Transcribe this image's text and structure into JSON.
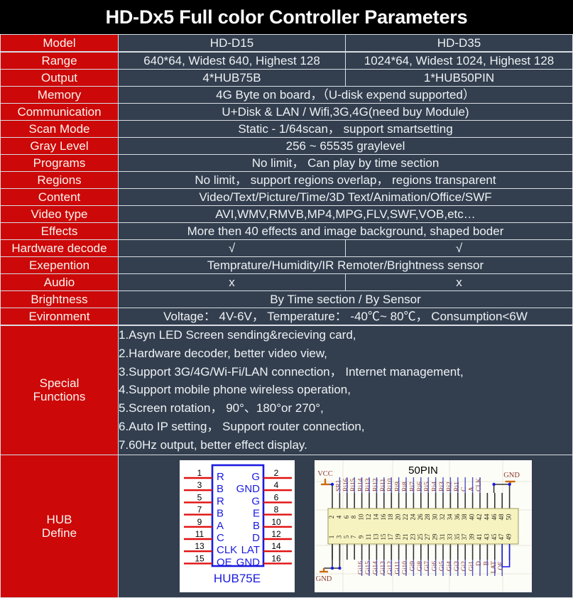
{
  "title": "HD-Dx5 Full color Controller Parameters",
  "columns": {
    "label": "Model",
    "col1": "HD-D15",
    "col2": "HD-D35"
  },
  "rows": [
    {
      "label": "Range",
      "split": true,
      "v1": "640*64, Widest 640, Highest 128",
      "v2": "1024*64, Widest 1024, Highest 128"
    },
    {
      "label": "Output",
      "split": true,
      "v1": "4*HUB75B",
      "v2": "1*HUB50PIN"
    },
    {
      "label": "Memory",
      "split": false,
      "v1": "4G Byte on board，（U-disk expend supported）"
    },
    {
      "label": "Communication",
      "split": false,
      "v1": "U+Disk & LAN / Wifi,3G,4G(need buy Module)"
    },
    {
      "label": "Scan Mode",
      "split": false,
      "v1": "Static - 1/64scan， support smartsetting"
    },
    {
      "label": "Gray Level",
      "split": false,
      "v1": "256 ~ 65535 graylevel"
    },
    {
      "label": "Programs",
      "split": false,
      "v1": "No limit， Can play by time section"
    },
    {
      "label": "Regions",
      "split": false,
      "v1": "No limit， support regions overlap， regions transparent"
    },
    {
      "label": "Content",
      "split": false,
      "v1": "Video/Text/Picture/Time/3D Text/Animation/Office/SWF"
    },
    {
      "label": "Video type",
      "split": false,
      "v1": "AVI,WMV,RMVB,MP4,MPG,FLV,SWF,VOB,etc…"
    },
    {
      "label": "Effects",
      "split": false,
      "v1": "More then 40 effects and image background, shaped boder"
    },
    {
      "label": "Hardware decode",
      "split": true,
      "v1": "√",
      "v2": "√"
    },
    {
      "label": "Exepention",
      "split": false,
      "v1": "Temprature/Humidity/IR Remoter/Brightness sensor"
    },
    {
      "label": "Audio",
      "split": true,
      "v1": "x",
      "v2": "x"
    },
    {
      "label": "Brightness",
      "split": false,
      "v1": "By Time section / By Sensor"
    },
    {
      "label": "Evironment",
      "split": false,
      "v1": "Voltage： 4V-6V， Temperature： -40℃~ 80℃， Consumption<6W"
    }
  ],
  "special": {
    "label_line1": "Special",
    "label_line2": "Functions",
    "items": [
      "1.Asyn LED Screen sending&recieving card,",
      "2.Hardware decoder, better video view,",
      "3.Support 3G/4G/Wi-Fi/LAN connection， Internet management,",
      "4.Support mobile phone wireless operation,",
      "5.Screen rotation， 90°、180°or 270°,",
      "6.Auto IP setting， Support router connection,",
      "7.60Hz output, better effect display."
    ]
  },
  "hub": {
    "label_line1": "HUB",
    "label_line2": "Define",
    "hub75e": {
      "caption": "HUB75E",
      "left_pins": [
        "1",
        "3",
        "5",
        "7",
        "9",
        "11",
        "13",
        "15"
      ],
      "left_signals": [
        "R",
        "B",
        "R",
        "B",
        "A",
        "C",
        "CLK",
        "OE"
      ],
      "right_pins": [
        "2",
        "4",
        "6",
        "8",
        "10",
        "12",
        "14",
        "16"
      ],
      "right_signals": [
        "G",
        "GND",
        "G",
        "E",
        "B",
        "D",
        "LAT",
        "GND"
      ]
    },
    "hub50": {
      "caption": "50PIN",
      "top_labels": [
        "VCC",
        "SR1",
        "Ri16",
        "Ri15",
        "Ri14",
        "Ri13",
        "Ri12",
        "Ri11",
        "Ri10",
        "Ri9",
        "Ri8",
        "Ri7",
        "Ri6",
        "Ri5",
        "Ri4",
        "Ri3",
        "Ri2",
        "Ri1",
        "C",
        "A",
        "CLK",
        "GND"
      ],
      "bottom_labels": [
        "GND",
        "Gi16",
        "Gi15",
        "Gi14",
        "Gi13",
        "Gi12",
        "Gi11",
        "Gi10",
        "Gi9",
        "Gi8",
        "Gi7",
        "Gi6",
        "Gi5",
        "Gi4",
        "Gi3",
        "Gi2",
        "Gi1",
        "D",
        "B",
        "LAT",
        "OE"
      ],
      "even_pins": [
        "2",
        "4",
        "6",
        "8",
        "10",
        "12",
        "14",
        "16",
        "18",
        "20",
        "22",
        "24",
        "26",
        "28",
        "30",
        "32",
        "34",
        "36",
        "38",
        "40",
        "42",
        "44",
        "46",
        "48",
        "50"
      ],
      "odd_pins": [
        "1",
        "3",
        "5",
        "7",
        "9",
        "11",
        "13",
        "15",
        "17",
        "19",
        "21",
        "23",
        "25",
        "27",
        "29",
        "31",
        "33",
        "35",
        "37",
        "39",
        "41",
        "43",
        "45",
        "47",
        "49"
      ]
    }
  },
  "colors": {
    "label_red": "#cc0808",
    "value_slate": "#333f4f",
    "title_black": "#000000",
    "grid_line": "#d8dde3",
    "schematic_blue": "#1a1ae0",
    "schematic_red": "#e01010",
    "pin_body": "#f7f3c0"
  }
}
